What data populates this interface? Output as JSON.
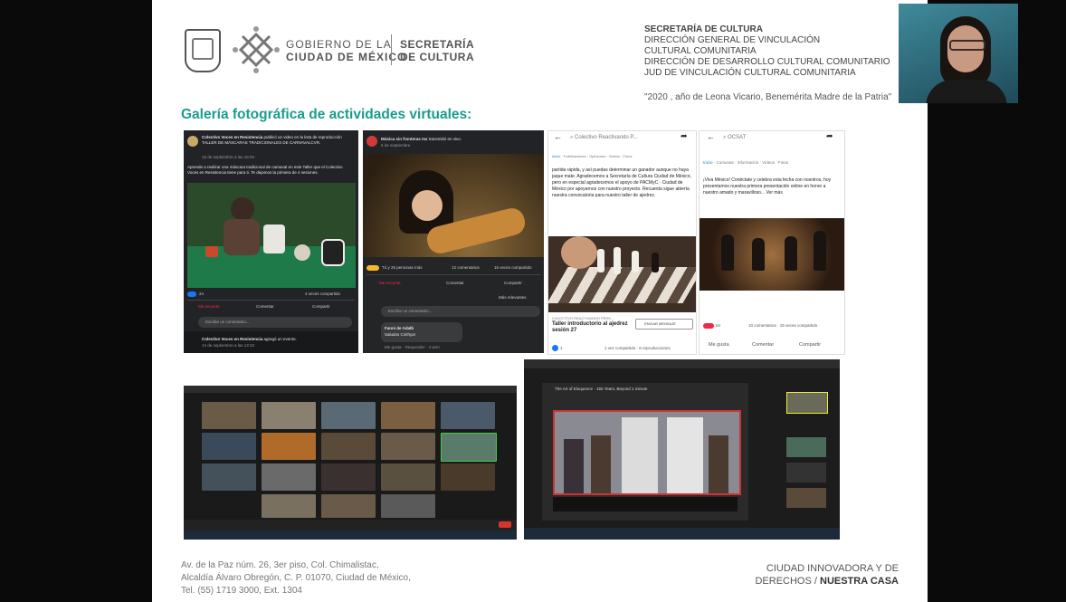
{
  "header": {
    "gobierno_line1": "GOBIERNO DE LA",
    "gobierno_line2": "CIUDAD DE MÉXICO",
    "secretaria_line1": "SECRETARÍA",
    "secretaria_line2": "DE CULTURA",
    "right_lines": [
      "SECRETARÍA DE CULTURA",
      "DIRECCIÓN GENERAL DE VINCULACIÓN",
      "CULTURAL COMUNITARIA",
      "DIRECCIÓN DE DESARROLLO CULTURAL COMUNITARIO",
      "JUD DE VINCULACIÓN CULTURAL COMUNITARIA"
    ],
    "quote": "\"2020 , año de Leona Vicario, Benemérita Madre de la Patria\""
  },
  "gallery_title": "Galería fotográfica de actividades virtuales:",
  "shots": {
    "s1": {
      "author": "Colectivo Voces en Resistencia",
      "header": "publicó un video en la lista de reproducción TALLER DE MÁSCARAS TRADICIONALES DE CARNAVALCVR.",
      "date": "15 de septiembre a las 16:00 · ",
      "body": "Aprende a realizar una máscara tradicional de carnaval en este Taller que el Colectivo Voces en Resistencia tiene para ti. Te dejamos la primera de 4 sesiones.",
      "reactions": "24",
      "shares": "4 veces compartido",
      "like": "Me encanta",
      "comment": "Comentar",
      "share": "Compartir",
      "input": "Escribe un comentario...",
      "footer_author": "Colectivo Voces en Resistencia",
      "footer_action": "agregó un evento.",
      "footer_date": "14 de septiembre a las 13:10 · "
    },
    "s2": {
      "author": "Música sin fronteras mx",
      "action": "transmitió en vivo.",
      "date": "6 de septiembre · ",
      "reactions": "Tú y 25 personas más",
      "comments": "12 comentarios",
      "shares": "16 veces compartido",
      "like": "Me encanta",
      "comment": "Comentar",
      "share": "Compartir",
      "relevant": "Más relevantes",
      "input": "Escribe un comentario...",
      "reply_author": "Fanni de Adalb",
      "reply_text": "Saludos Cinthya!",
      "reply_actions": "Me gusta · Responder · 4 sem"
    },
    "s3": {
      "search": "Colectivo Reactivando P...",
      "tabs": [
        "Inicio",
        "Publicaciones",
        "Opiniones",
        "Videos",
        "Fotos"
      ],
      "body": "partida rápida, y así puedas determinar un ganador aunque no haya jaque mate. Agradecemos a Secretaría de Cultura Ciudad de México, pero en especial agradecemos el apoyo de PACMyC · Ciudad de México por apoyarnos con nuestro proyecto. Recuerda sigue abierta nuestra convocatoria para nuestro taller de ajedrez.",
      "page_label": "COLECTIVO REACTIVANDO PERS...",
      "post_title": "Taller introductorio al ajedrez sesión 27",
      "message_btn": "ENVIAR MENSAJE",
      "reactions": "1",
      "stats": "1 vez compartido · 8 reproducciones"
    },
    "s4": {
      "search": "OCSAT",
      "tabs": [
        "Inicio",
        "Comunas",
        "Información",
        "Videos",
        "Fotos"
      ],
      "body": "¡Viva México! Conéctate y celebra esta fecha con nosotros, hoy presentamos nuestra primera presentación online en honor a nuestro amado y maravilloso... Ver más",
      "reactions": "54",
      "stats": "10 comentarios · 15 veces compartido",
      "like": "Me gusta",
      "comment": "Comentar",
      "share": "Compartir"
    },
    "s6": {
      "meeting_title": "The Art of Eloquence · 150 Years, Beyond 1 minute"
    }
  },
  "footer": {
    "addr1": "Av. de la Paz núm. 26, 3er piso, Col. Chimalistac,",
    "addr2": "Alcaldía Álvaro Obregón, C. P. 01070, Ciudad de México,",
    "addr3": "Tel. (55) 1719 3000, Ext. 1304",
    "right1": "CIUDAD INNOVADORA Y DE",
    "right2": "DERECHOS / ",
    "right3": "NUESTRA CASA"
  },
  "colors": {
    "accent": "#1a9c8c",
    "fb_blue": "#1877f2",
    "fb_dark": "#242526"
  }
}
